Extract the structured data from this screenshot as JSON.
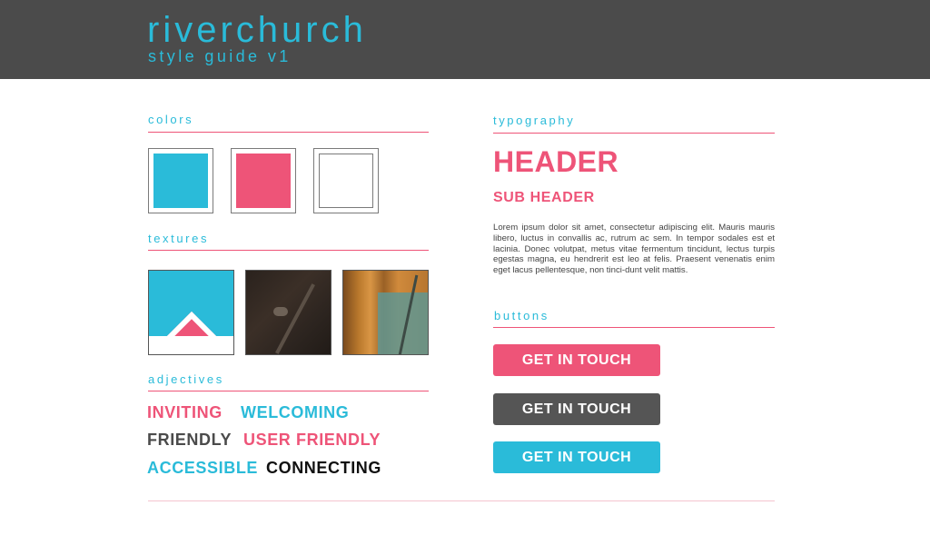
{
  "header": {
    "title": "riverchurch",
    "subtitle": "style guide v1"
  },
  "colors_section": {
    "label": "colors",
    "swatches": [
      {
        "name": "cyan",
        "hex": "#2abbd9"
      },
      {
        "name": "pink",
        "hex": "#ee5478"
      },
      {
        "name": "white",
        "hex": "#ffffff"
      }
    ]
  },
  "textures_section": {
    "label": "textures"
  },
  "adjectives_section": {
    "label": "adjectives",
    "words": [
      {
        "text": "INVITING",
        "color": "#ee5478"
      },
      {
        "text": "WELCOMING",
        "color": "#2abbd9"
      },
      {
        "text": "FRIENDLY",
        "color": "#4b4b4b"
      },
      {
        "text": "USER FRIENDLY",
        "color": "#ee5478"
      },
      {
        "text": "ACCESSIBLE",
        "color": "#2abbd9"
      },
      {
        "text": "CONNECTING",
        "color": "#111111"
      }
    ]
  },
  "typography_section": {
    "label": "typography",
    "header_sample": "HEADER",
    "subheader_sample": "SUB HEADER",
    "body_sample": "Lorem ipsum dolor sit amet, consectetur adipiscing elit. Mauris mauris libero, luctus in convallis ac, rutrum ac sem. In tempor sodales est et lacinia. Donec volutpat, metus vitae fermentum tincidunt, lectus turpis egestas magna, eu hendrerit est leo at felis. Praesent venenatis enim eget lacus pellentesque, non tinci-dunt velit mattis."
  },
  "buttons_section": {
    "label": "buttons",
    "buttons": [
      {
        "label": "GET IN TOUCH",
        "color": "#ee5478"
      },
      {
        "label": "GET IN TOUCH",
        "color": "#555555"
      },
      {
        "label": "GET IN TOUCH",
        "color": "#2abbd9"
      }
    ]
  },
  "accent_colors": {
    "cyan": "#2abbd9",
    "pink": "#ee5478",
    "dark": "#4b4b4b"
  }
}
